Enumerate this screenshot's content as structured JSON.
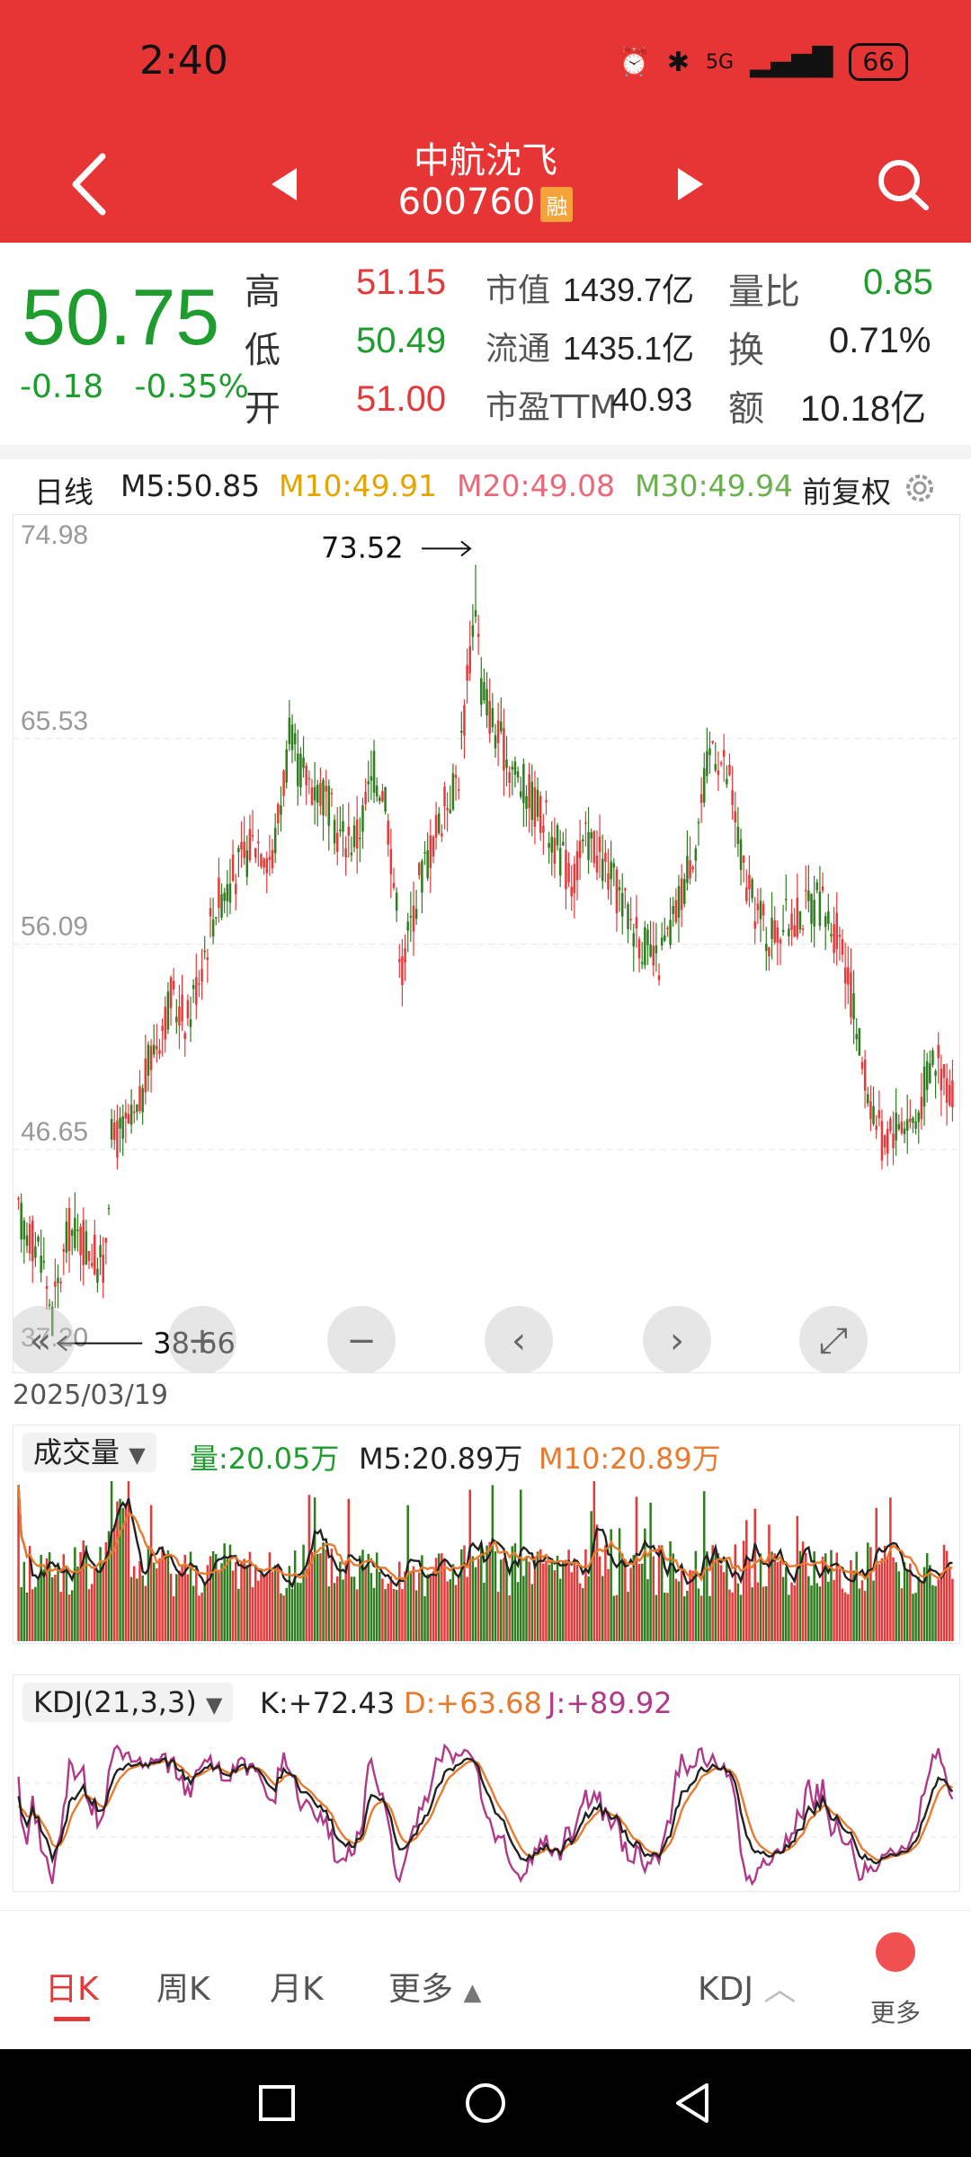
{
  "status": {
    "time": "2:40",
    "battery": "66",
    "network": "5G"
  },
  "header": {
    "name": "中航沈飞",
    "code": "600760",
    "badge": "融"
  },
  "quote": {
    "price": "50.75",
    "change": "-0.18",
    "change_pct": "-0.35%",
    "high_label": "高",
    "high": "51.15",
    "low_label": "低",
    "low": "50.49",
    "open_label": "开",
    "open": "51.00",
    "mktcap_label": "市值",
    "mktcap": "1439.7亿",
    "float_label": "流通",
    "float": "1435.1亿",
    "pe_label": "市盈TTM",
    "pe": "40.93",
    "volratio_label": "量比",
    "volratio": "0.85",
    "turnover_label": "换",
    "turnover": "0.71%",
    "amount_label": "额",
    "amount": "10.18亿"
  },
  "ma_row": {
    "period": "日线",
    "m5": "M5:50.85",
    "m10": "M10:49.91",
    "m20": "M20:49.08",
    "m30": "M30:49.94",
    "adjust": "前复权",
    "colors": {
      "m5": "#222222",
      "m10": "#e6a400",
      "m20": "#e86a7a",
      "m30": "#6ab04c"
    }
  },
  "chart_data": [
    {
      "type": "candlestick",
      "y_ticks": [
        "74.98",
        "65.53",
        "56.09",
        "46.65",
        "37.20"
      ],
      "ylim": [
        37.2,
        74.98
      ],
      "high_marker": "73.52",
      "low_marker": "38.66",
      "start_date": "2025/03/19",
      "anchors": [
        [
          0,
          43.5
        ],
        [
          8,
          42
        ],
        [
          12,
          39
        ],
        [
          18,
          43
        ],
        [
          26,
          42
        ],
        [
          30,
          41
        ],
        [
          33,
          47
        ],
        [
          42,
          48
        ],
        [
          47,
          51
        ],
        [
          54,
          53.5
        ],
        [
          60,
          52.6
        ],
        [
          70,
          58
        ],
        [
          80,
          60
        ],
        [
          84,
          61
        ],
        [
          90,
          60
        ],
        [
          96,
          65.5
        ],
        [
          100,
          64
        ],
        [
          108,
          63
        ],
        [
          114,
          61
        ],
        [
          120,
          61
        ],
        [
          126,
          64
        ],
        [
          130,
          63
        ],
        [
          136,
          55
        ],
        [
          142,
          59
        ],
        [
          150,
          62
        ],
        [
          156,
          64
        ],
        [
          162,
          72
        ],
        [
          164,
          68
        ],
        [
          170,
          65.5
        ],
        [
          178,
          63.5
        ],
        [
          186,
          62
        ],
        [
          196,
          59
        ],
        [
          202,
          61
        ],
        [
          212,
          58.5
        ],
        [
          220,
          56.5
        ],
        [
          226,
          55
        ],
        [
          232,
          57
        ],
        [
          240,
          61
        ],
        [
          246,
          65.5
        ],
        [
          252,
          63.5
        ],
        [
          258,
          58.5
        ],
        [
          266,
          56.5
        ],
        [
          276,
          57.5
        ],
        [
          284,
          58
        ],
        [
          292,
          56
        ],
        [
          300,
          50
        ],
        [
          306,
          47
        ],
        [
          312,
          48
        ],
        [
          318,
          48
        ],
        [
          324,
          51
        ],
        [
          330,
          49.5
        ]
      ]
    },
    {
      "type": "bar",
      "title": "成交量",
      "label_vol": "量:20.05万",
      "label_m5": "M5:20.89万",
      "label_m10": "M10:20.89万"
    },
    {
      "type": "line",
      "title": "KDJ(21,3,3)",
      "label_k": "K:+72.43",
      "label_d": "D:+63.68",
      "label_j": "J:+89.92",
      "colors": {
        "k": "#222222",
        "d": "#e87a2e",
        "j": "#b03a8a"
      }
    }
  ],
  "chart_controls": [
    "«",
    "+",
    "−",
    "‹",
    "›",
    "⤢"
  ],
  "tabs": {
    "day": "日K",
    "week": "周K",
    "month": "月K",
    "more": "更多",
    "indicator": "KDJ",
    "more2": "更多"
  }
}
